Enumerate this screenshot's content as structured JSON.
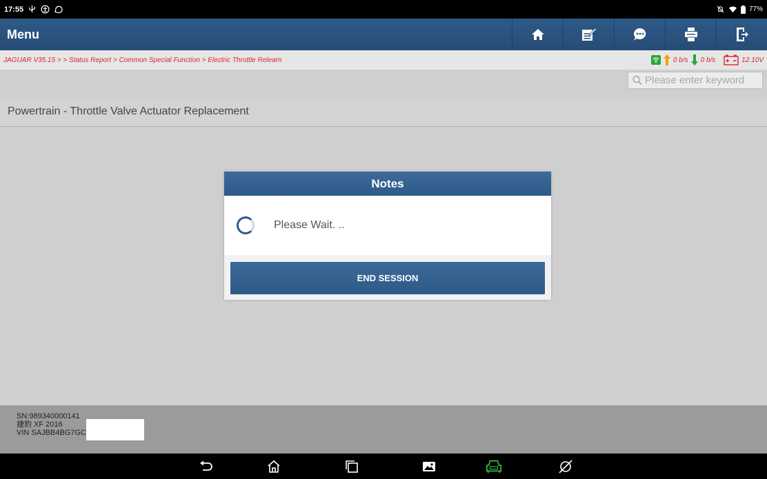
{
  "status_bar": {
    "time": "17:55",
    "battery": "77%",
    "icons_left": [
      "usb-icon",
      "accessibility-icon",
      "chat-icon"
    ],
    "icons_right": [
      "mute-icon",
      "wifi-icon",
      "battery-icon"
    ]
  },
  "header": {
    "title": "Menu",
    "toolbar": [
      "home-icon",
      "edit-icon",
      "chat-icon",
      "print-icon",
      "exit-icon"
    ]
  },
  "breadcrumb": {
    "path": "JAGUAR V35.15 > > Status Report > Common Special Function > Electric Throttle Relearn",
    "upload_rate": "0 b/s",
    "download_rate": "0 b/s",
    "voltage": "12.10V"
  },
  "search": {
    "placeholder": "Please enter keyword"
  },
  "content": {
    "title": "Powertrain - Throttle Valve Actuator Replacement"
  },
  "modal": {
    "title": "Notes",
    "message": "Please Wait. ..",
    "button_label": "END SESSION"
  },
  "footer": {
    "sn": "SN:989340000141",
    "model": "捷豹 XF 2016",
    "vin": "VIN SAJBB4BG7GC"
  },
  "nav_bar": [
    "back-icon",
    "home-icon",
    "recents-icon",
    "screenshot-icon",
    "vci-icon",
    "browser-icon"
  ],
  "colors": {
    "header": "#2b5580",
    "accent_red": "#d9262d",
    "content_bg": "#cfcfcf"
  }
}
